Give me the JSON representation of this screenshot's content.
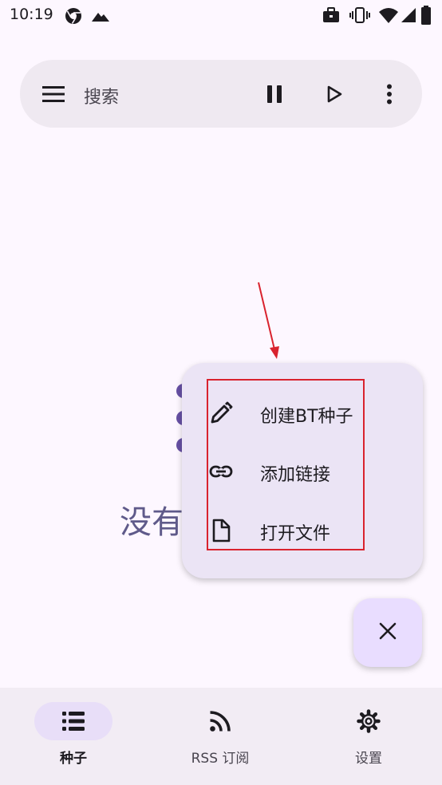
{
  "status_bar": {
    "time": "10:19",
    "left_icons": [
      "chrome-icon",
      "mountain-icon"
    ],
    "right_icons": [
      "briefcase-icon",
      "vibrate-icon",
      "wifi-icon",
      "signal-icon",
      "battery-icon"
    ]
  },
  "search_bar": {
    "menu_icon": "hamburger-menu-icon",
    "placeholder": "搜索",
    "actions": [
      "pause-icon",
      "play-icon",
      "more-vert-icon"
    ]
  },
  "empty_state": {
    "text": "没有"
  },
  "fab_menu": {
    "items": [
      {
        "icon": "pencil-icon",
        "label": "创建BT种子"
      },
      {
        "icon": "link-icon",
        "label": "添加链接"
      },
      {
        "icon": "file-icon",
        "label": "打开文件"
      }
    ]
  },
  "fab": {
    "icon": "close-icon"
  },
  "bottom_nav": {
    "items": [
      {
        "icon": "list-icon",
        "label": "种子",
        "active": true
      },
      {
        "icon": "rss-icon",
        "label": "RSS 订阅",
        "active": false
      },
      {
        "icon": "gear-icon",
        "label": "设置",
        "active": false
      }
    ]
  },
  "colors": {
    "background": "#fdf7ff",
    "accent": "#6750a4",
    "annotation": "#d9232e"
  }
}
